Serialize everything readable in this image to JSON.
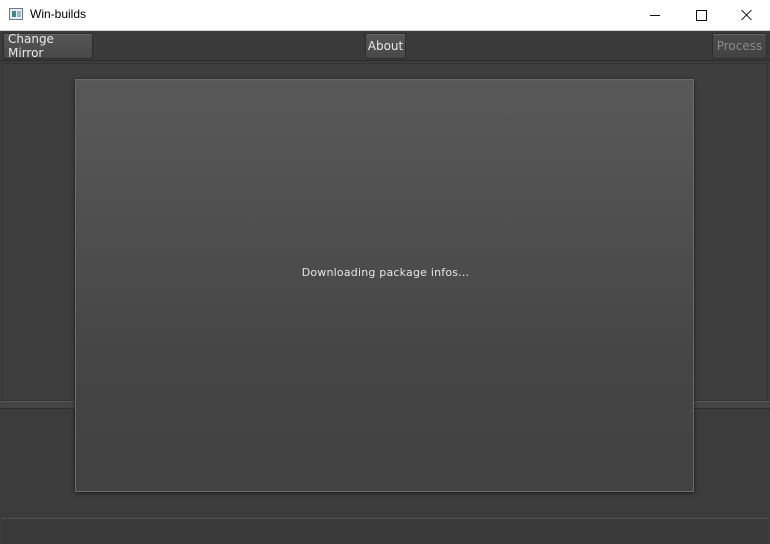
{
  "window": {
    "title": "Win-builds",
    "minimize_label": "",
    "maximize_label": "",
    "close_label": ""
  },
  "toolbar": {
    "change_mirror_label": "Change Mirror",
    "about_label": "About",
    "process_label": "Process",
    "process_enabled": false
  },
  "status": {
    "message": "Downloading package infos..."
  },
  "colors": {
    "background": "#3c3c3c",
    "panel": "#4f4f4f",
    "text": "#e6e6e6",
    "disabled_text": "#8a8a8a"
  },
  "icons": {
    "app": "app-window-icon",
    "minimize": "minimize-icon",
    "maximize": "maximize-icon",
    "close": "close-icon"
  }
}
